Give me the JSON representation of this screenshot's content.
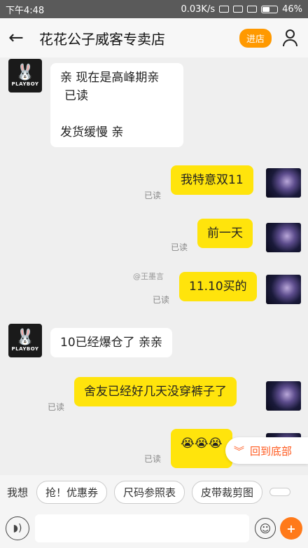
{
  "status_bar": {
    "time": "下午4:48",
    "net_speed": "0.03K/s",
    "battery": "46%"
  },
  "header": {
    "back_icon": "back-arrow-icon",
    "title": "花花公子威客专卖店",
    "enter_shop": "进店",
    "user_icon": "user-icon"
  },
  "chat": {
    "msg1": {
      "line1": "亲 现在是高峰期亲",
      "line2": "已读",
      "line3": "发货缓慢 亲"
    },
    "msg2": {
      "text": "我特意双11",
      "read": "已读"
    },
    "msg3": {
      "text": "前一天",
      "read": "已读"
    },
    "watermark": "@王墨言",
    "msg4": {
      "text": "11.10买的",
      "read": "已读"
    },
    "msg5": {
      "text": "10已经爆仓了 亲亲"
    },
    "msg6": {
      "text": "舍友已经好几天没穿裤子了",
      "read": "已读"
    },
    "msg7": {
      "text": "😭😭😭",
      "read": "已读"
    },
    "brand": "PLAYBOY"
  },
  "scroll_bottom": {
    "label": "回到底部"
  },
  "quick_replies": {
    "label": "我想",
    "items": [
      "抢！优惠券",
      "尺码参照表",
      "皮带裁剪图"
    ]
  },
  "input_bar": {
    "voice_icon": "voice-icon",
    "emoji_icon": "emoji-icon",
    "plus_icon": "plus-icon"
  },
  "colors": {
    "accent": "#ff9900",
    "bubble_self": "#ffe40c",
    "scroll_text": "#ff5a1f"
  }
}
